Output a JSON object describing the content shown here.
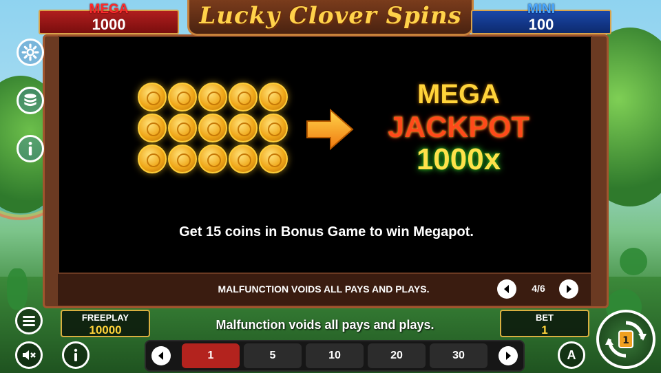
{
  "game": {
    "title": "Lucky Clover Spins"
  },
  "jackpots": {
    "mega": {
      "label": "MEGA",
      "value": "1000"
    },
    "mini": {
      "label": "MINI",
      "value": "100"
    }
  },
  "side_buttons": [
    {
      "icon": "gear-icon"
    },
    {
      "icon": "coin-stack-icon"
    },
    {
      "icon": "info-icon"
    }
  ],
  "info_panel": {
    "coin_count": 15,
    "mega_word": "MEGA",
    "jackpot_word": "JACKPOT",
    "multiplier": "1000x",
    "description": "Get 15 coins in Bonus Game to win Megapot."
  },
  "pager": {
    "text": "MALFUNCTION VOIDS ALL PAYS AND PLAYS.",
    "page": "4/6"
  },
  "bottom": {
    "freeplay_label": "FREEPLAY",
    "freeplay_value": "10000",
    "malfunction_text": "Malfunction voids all pays and plays.",
    "bet_label": "BET",
    "bet_value": "1",
    "bet_options": [
      "1",
      "5",
      "10",
      "20",
      "30"
    ],
    "selected_bet": "1",
    "auto_label": "A"
  },
  "colors": {
    "mega_red": "#b01e1e",
    "mini_blue": "#1a47a8",
    "gold": "#ffd33a",
    "selected_bet": "#b3231e"
  }
}
